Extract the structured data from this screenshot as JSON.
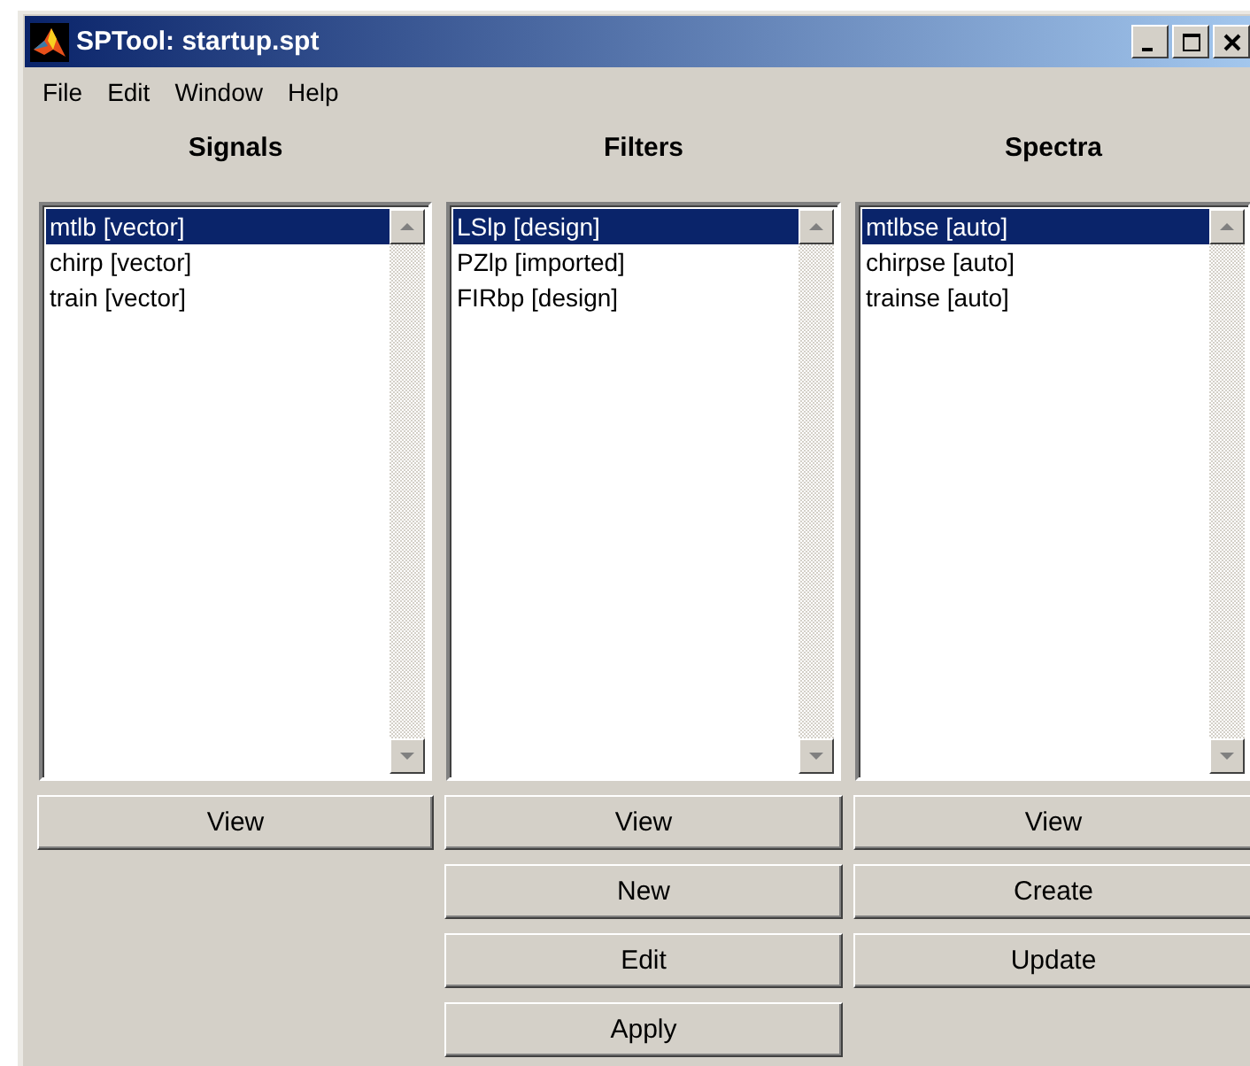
{
  "window": {
    "title": "SPTool: startup.spt"
  },
  "menu": [
    "File",
    "Edit",
    "Window",
    "Help"
  ],
  "columns": [
    {
      "title": "Signals",
      "items": [
        {
          "label": "mtlb [vector]",
          "selected": true
        },
        {
          "label": "chirp [vector]",
          "selected": false
        },
        {
          "label": "train [vector]",
          "selected": false
        }
      ],
      "buttons": [
        "View"
      ]
    },
    {
      "title": "Filters",
      "items": [
        {
          "label": "LSlp [design]",
          "selected": true
        },
        {
          "label": "PZlp [imported]",
          "selected": false
        },
        {
          "label": "FIRbp [design]",
          "selected": false
        }
      ],
      "buttons": [
        "View",
        "New",
        "Edit",
        "Apply"
      ]
    },
    {
      "title": "Spectra",
      "items": [
        {
          "label": "mtlbse [auto]",
          "selected": true
        },
        {
          "label": "chirpse [auto]",
          "selected": false
        },
        {
          "label": "trainse [auto]",
          "selected": false
        }
      ],
      "buttons": [
        "View",
        "Create",
        "Update"
      ]
    }
  ]
}
